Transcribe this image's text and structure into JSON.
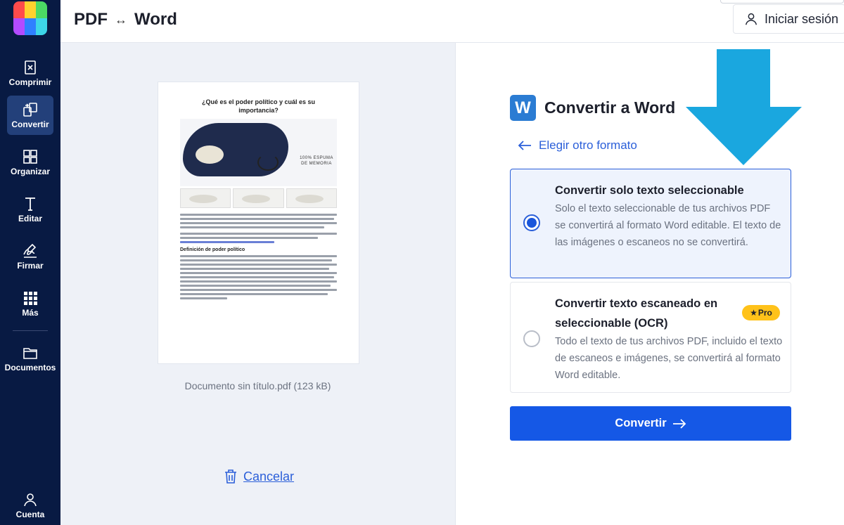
{
  "app": {
    "title_left": "PDF",
    "title_arrow": "↔",
    "title_right": "Word"
  },
  "header": {
    "login_label": "Iniciar sesión"
  },
  "sidebar": {
    "items": [
      {
        "label": "Comprimir",
        "icon": "compress-icon"
      },
      {
        "label": "Convertir",
        "icon": "convert-icon",
        "active": true
      },
      {
        "label": "Organizar",
        "icon": "organize-icon"
      },
      {
        "label": "Editar",
        "icon": "edit-text-icon"
      },
      {
        "label": "Firmar",
        "icon": "sign-icon"
      },
      {
        "label": "Más",
        "icon": "more-grid-icon"
      },
      {
        "label": "Documentos",
        "icon": "folder-icon"
      }
    ],
    "account_label": "Cuenta"
  },
  "preview": {
    "doc_title": "¿Qué es el poder político y cuál es su importancia?",
    "doc_image_caption": "100% ESPUMA DE MEMORIA",
    "doc_subheading": "Definición de poder político",
    "file_name": "Documento sin título.pdf (123 kB)",
    "cancel_label": "Cancelar"
  },
  "panel": {
    "title": "Convertir a Word",
    "word_icon_letter": "W",
    "back_label": "Elegir otro formato",
    "options": [
      {
        "title": "Convertir solo texto seleccionable",
        "description": "Solo el texto seleccionable de tus archivos PDF se convertirá al formato Word editable. El texto de las imágenes o escaneos no se convertirá.",
        "selected": true
      },
      {
        "title": "Convertir texto escaneado en seleccionable (OCR)",
        "description": "Todo el texto de tus archivos PDF, incluido el texto de escaneos e imágenes, se convertirá al formato Word editable.",
        "badge": "Pro",
        "badge_star": "★",
        "selected": false
      }
    ],
    "convert_label": "Convertir"
  },
  "colors": {
    "sidebar_bg": "#081a43",
    "primary_blue": "#1558e6",
    "annotation_arrow": "#1aa7df",
    "pro_badge": "#ffc21a"
  }
}
